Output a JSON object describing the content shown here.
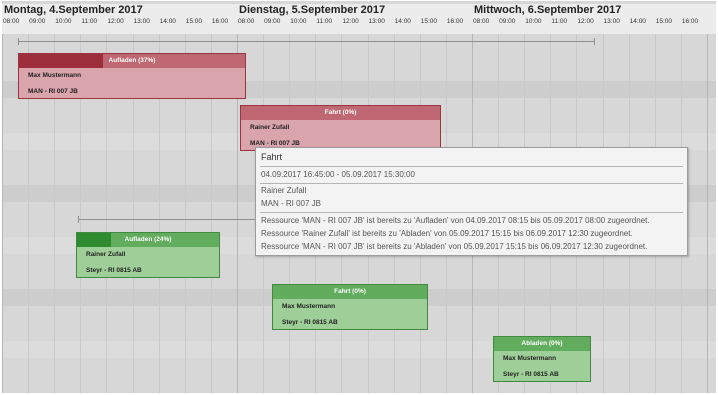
{
  "days": [
    {
      "title": "Montag, 4.September 2017",
      "hours": [
        "08:00",
        "09:00",
        "10:00",
        "11:00",
        "12:00",
        "13:00",
        "14:00",
        "15:00",
        "16:00"
      ]
    },
    {
      "title": "Dienstag, 5.September 2017",
      "hours": [
        "08:00",
        "09:00",
        "10:00",
        "11:00",
        "12:00",
        "13:00",
        "14:00",
        "15:00",
        "16:00"
      ]
    },
    {
      "title": "Mittwoch, 6.September 2017",
      "hours": [
        "08:00",
        "09:00",
        "10:00",
        "11:00",
        "12:00",
        "13:00",
        "14:00",
        "15:00",
        "16:00"
      ]
    }
  ],
  "tasks": [
    {
      "label": "Aufladen (37%)",
      "progress": 37,
      "driver": "Max Mustermann",
      "vehicle": "MAN - RI 007 JB",
      "status": "conflict"
    },
    {
      "label": "Fahrt (0%)",
      "progress": 0,
      "driver": "Rainer Zufall",
      "vehicle": "MAN - RI 007 JB",
      "status": "conflict"
    },
    {
      "label": "Aufladen (24%)",
      "progress": 24,
      "driver": "Rainer Zufall",
      "vehicle": "Steyr - RI 0815 AB",
      "status": "ok"
    },
    {
      "label": "Fahrt (0%)",
      "progress": 0,
      "driver": "Max Mustermann",
      "vehicle": "Steyr - RI 0815 AB",
      "status": "ok"
    },
    {
      "label": "Abladen (0%)",
      "progress": 0,
      "driver": "Max Mustermann",
      "vehicle": "Steyr - RI 0815 AB",
      "status": "ok"
    }
  ],
  "tooltip": {
    "title": "Fahrt",
    "period": "04.09.2017 16:45:00 - 05.09.2017 15:30:00",
    "driver": "Rainer Zufall",
    "vehicle": "MAN - RI 007 JB",
    "messages": [
      "Ressource 'MAN - RI 007 JB' ist bereits zu 'Aufladen' von 04.09.2017 08:15 bis 05.09.2017 08:00 zugeordnet.",
      "Ressource 'Rainer Zufall' ist bereits zu 'Abladen' von 05.09.2017 15:15 bis 06.09.2017 12:30 zugeordnet.",
      "Ressource 'MAN - RI 007 JB' ist bereits zu 'Abladen' von 05.09.2017 15:15 bis 06.09.2017 12:30 zugeordnet."
    ]
  },
  "colors": {
    "conflict": "#9c2f3b",
    "ok": "#2f8b2f"
  }
}
